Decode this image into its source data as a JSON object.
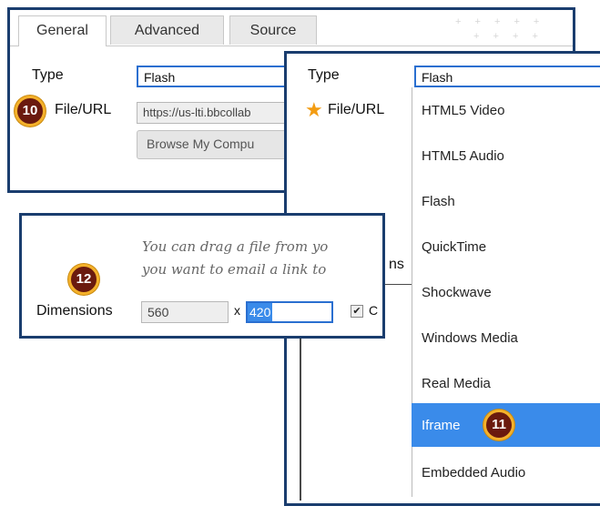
{
  "tabs": [
    {
      "label": "General"
    },
    {
      "label": "Advanced"
    },
    {
      "label": "Source"
    }
  ],
  "back_panel": {
    "type_label": "Type",
    "type_value": "Flash",
    "file_label": "File/URL",
    "file_value": "https://us-lti.bbcollab",
    "browse_label": "Browse My Compu"
  },
  "front_panel": {
    "type_label": "Type",
    "type_value": "Flash",
    "file_label": "File/URL",
    "partial_text": "ns",
    "options": [
      {
        "label": "HTML5 Video"
      },
      {
        "label": "HTML5 Audio"
      },
      {
        "label": "Flash"
      },
      {
        "label": "QuickTime"
      },
      {
        "label": "Shockwave"
      },
      {
        "label": "Windows Media"
      },
      {
        "label": "Real Media"
      },
      {
        "label": "Iframe",
        "selected": true
      },
      {
        "label": "Embedded Audio"
      }
    ]
  },
  "dimensions_panel": {
    "hint_line1": "You can drag a file from yo",
    "hint_line2": "you want to email a link to",
    "label": "Dimensions",
    "width": "560",
    "times": "x",
    "height": "420",
    "checkbox_partial": "C"
  },
  "markers": {
    "m10": "10",
    "m11": "11",
    "m12": "12"
  },
  "colors": {
    "panel_border": "#1a3d6e",
    "selection": "#3a8bea",
    "marker_fill": "#6b1a0e",
    "marker_ring": "#f4b12b",
    "required_star": "#f39c12"
  }
}
